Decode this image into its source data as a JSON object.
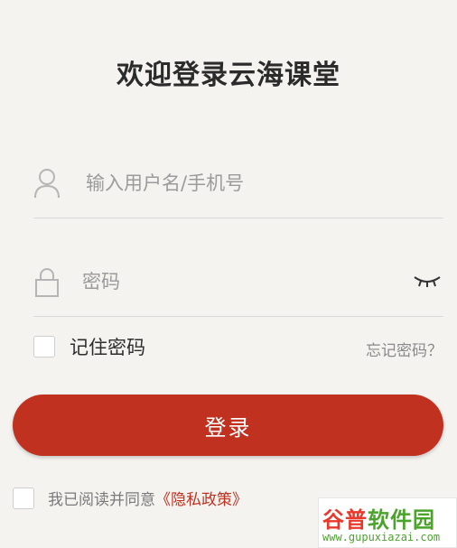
{
  "title": "欢迎登录云海课堂",
  "username": {
    "icon": "user-icon",
    "placeholder": "输入用户名/手机号",
    "value": ""
  },
  "password": {
    "icon": "lock-icon",
    "placeholder": "密码",
    "value": "",
    "toggle_icon": "eye-closed-icon"
  },
  "remember": {
    "label": "记住密码",
    "checked": false
  },
  "forgot_label": "忘记密码？",
  "login_label": "登录",
  "agreement": {
    "prefix": "我已阅读并同意",
    "link": "《隐私政策》",
    "checked": false
  },
  "watermark": {
    "brand_a": "谷普",
    "brand_b": "软件园",
    "url": "www.gupuxiazai.com"
  },
  "colors": {
    "accent": "#c0311f",
    "background": "#f4f3f0"
  }
}
